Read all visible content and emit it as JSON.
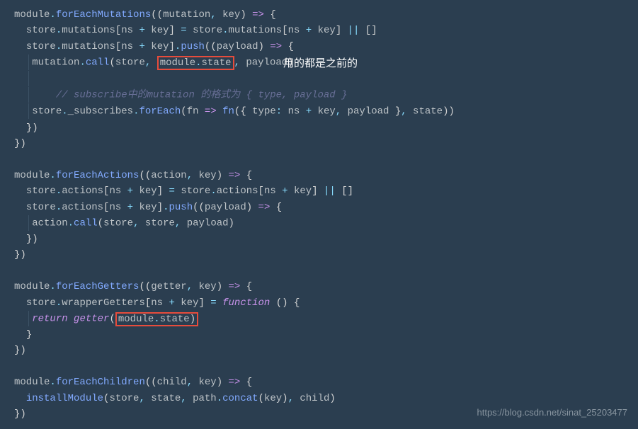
{
  "annotation": "用的都是之前的",
  "watermark": "https://blog.csdn.net/sinat_25203477",
  "lines": {
    "l1": "module.forEachMutations((mutation, key) => {",
    "l2": "  store.mutations[ns + key] = store.mutations[ns + key] || []",
    "l3a": "  store.mutations[ns + key].push((payload) => {",
    "l4a": "    mutation.call(store, ",
    "l4box": "module.state",
    "l4b": ", payload)",
    "l6": "    // subscribe中的mutation 的格式为 { type, payload }",
    "l7": "    store._subscribes.forEach(fn => fn({ type: ns + key, payload }, state))",
    "l8": "  })",
    "l9": "})",
    "l11": "module.forEachActions((action, key) => {",
    "l12": "  store.actions[ns + key] = store.actions[ns + key] || []",
    "l13": "  store.actions[ns + key].push((payload) => {",
    "l14": "    action.call(store, store, payload)",
    "l15": "  })",
    "l16": "})",
    "l18": "module.forEachGetters((getter, key) => {",
    "l19": "  store.wrapperGetters[ns + key] = function () {",
    "l20a": "    return getter(",
    "l20box": "module.state)",
    "l21": "  }",
    "l22": "})",
    "l24": "module.forEachChildren((child, key) => {",
    "l25": "  installModule(store, state, path.concat(key), child)",
    "l26": "})"
  }
}
